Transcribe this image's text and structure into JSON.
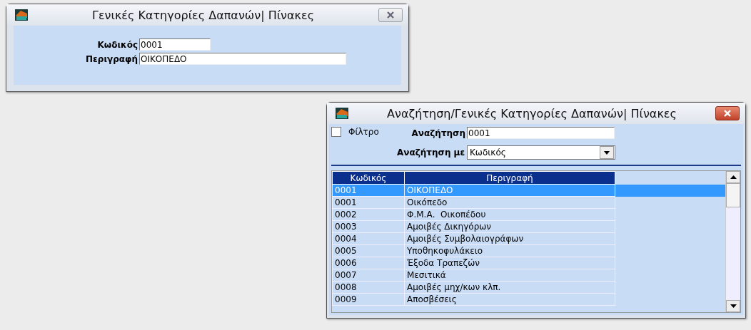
{
  "edit_window": {
    "title": "Γενικές Κατηγορίες Δαπανών| Πίνακες",
    "fields": [
      {
        "label": "Κωδικός",
        "value": "0001"
      },
      {
        "label": "Περιγραφή",
        "value": "ΟΙΚΟΠΕΔΟ"
      }
    ]
  },
  "search_window": {
    "title": "Αναζήτηση/Γενικές Κατηγορίες Δαπανών| Πίνακες",
    "filter": {
      "label": "Φίλτρο",
      "checked": false
    },
    "search": {
      "label": "Αναζήτηση",
      "value": "0001"
    },
    "search_by": {
      "label": "Αναζήτηση με",
      "value": "Κωδικός"
    },
    "table": {
      "columns": [
        "Κωδικός",
        "Περιγραφή"
      ],
      "rows": [
        {
          "cells": [
            "0001",
            "ΟΙΚΟΠΕΔΟ"
          ],
          "selected": true
        },
        {
          "cells": [
            "0001",
            "Οικόπεδο"
          ],
          "selected": false
        },
        {
          "cells": [
            "0002",
            "Φ.Μ.Α.  Οικοπέδου"
          ],
          "selected": false
        },
        {
          "cells": [
            "0003",
            "Αμοιβές Δικηγόρων"
          ],
          "selected": false
        },
        {
          "cells": [
            "0004",
            "Αμοιβές Συμβολαιογράφων"
          ],
          "selected": false
        },
        {
          "cells": [
            "0005",
            "Υποθηκοφυλάκειο"
          ],
          "selected": false
        },
        {
          "cells": [
            "0006",
            "Έξοδα Τραπεζών"
          ],
          "selected": false
        },
        {
          "cells": [
            "0007",
            "Μεσιτικά"
          ],
          "selected": false
        },
        {
          "cells": [
            "0008",
            "Αμοιβές μηχ/κων κλπ."
          ],
          "selected": false
        },
        {
          "cells": [
            "0009",
            "Αποσβέσεις"
          ],
          "selected": false
        }
      ]
    }
  }
}
